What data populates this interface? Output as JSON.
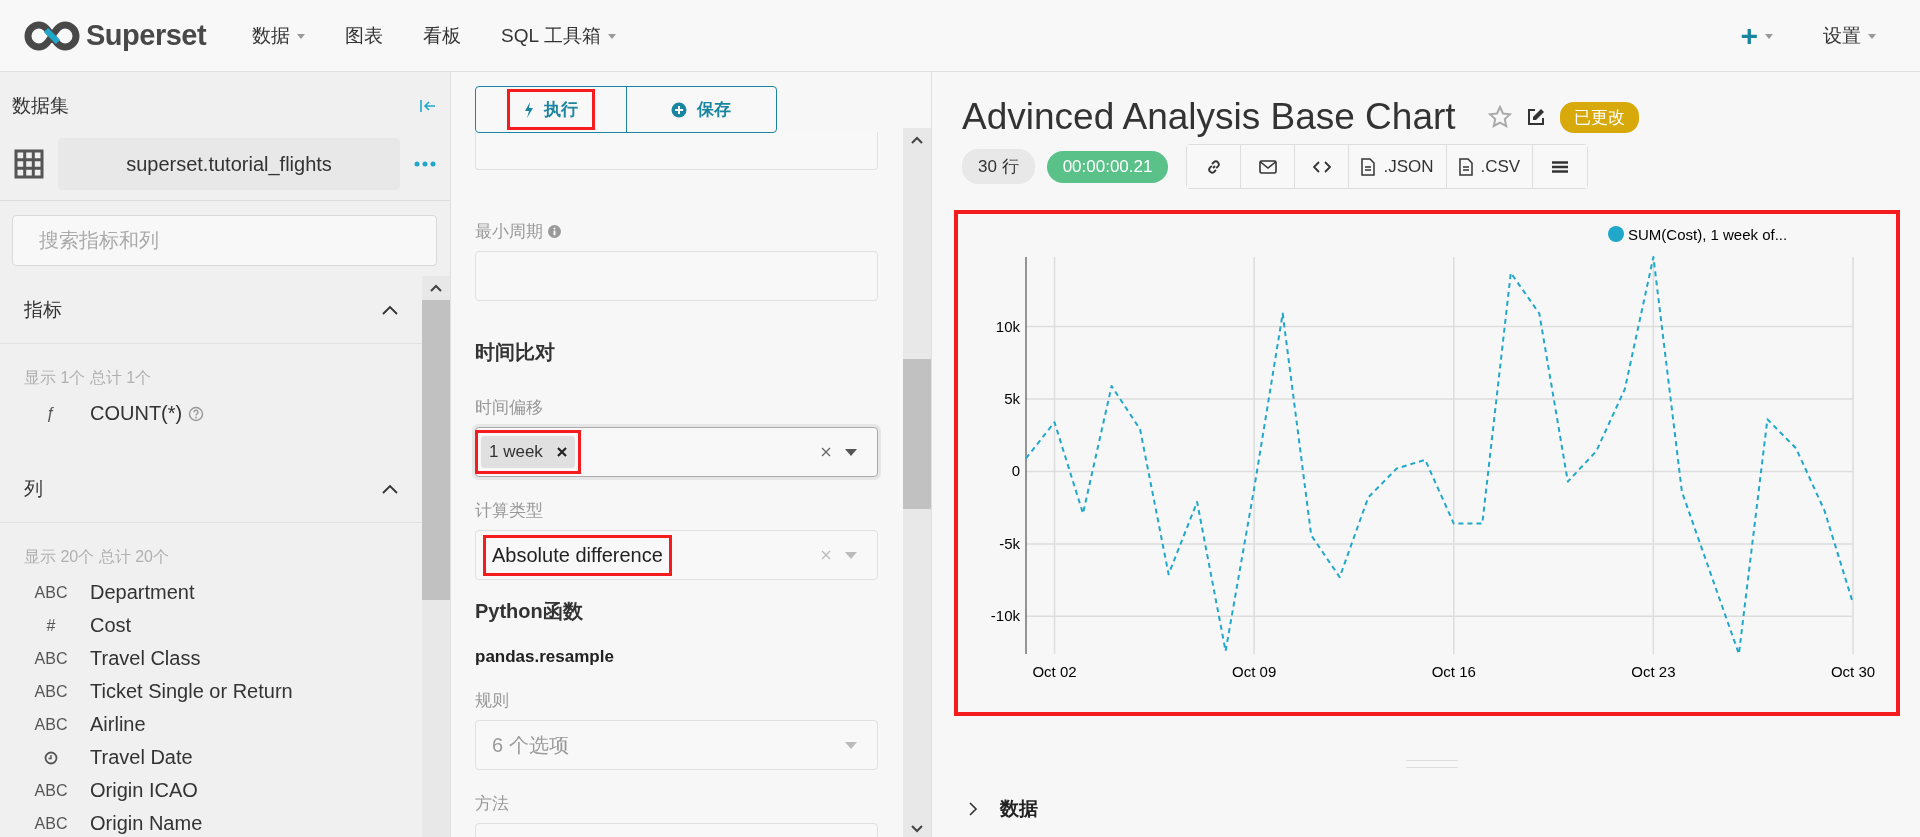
{
  "navbar": {
    "brand": "Superset",
    "menus": [
      {
        "label": "数据",
        "dropdown": true
      },
      {
        "label": "图表",
        "dropdown": false
      },
      {
        "label": "看板",
        "dropdown": false
      },
      {
        "label": "SQL 工具箱",
        "dropdown": true
      }
    ],
    "right_menus": [
      {
        "label": "+",
        "dropdown": true
      },
      {
        "label": "设置",
        "dropdown": true
      }
    ]
  },
  "datasource_panel": {
    "title": "数据集",
    "dataset": "superset.tutorial_flights",
    "search": {
      "placeholder": "搜索指标和列"
    },
    "sections": [
      {
        "title": "指标",
        "expanded": true,
        "count": "显示 1个 总计 1个",
        "items": [
          {
            "kind": "label",
            "type": "ƒ",
            "name": "COUNT(*)",
            "help": true
          }
        ]
      },
      {
        "title": "列",
        "expanded": true,
        "count": "显示 20个 总计 20个",
        "items": [
          {
            "kind": "label",
            "type": "ABC",
            "name": "Department",
            "help": false
          },
          {
            "kind": "label",
            "type": "#",
            "name": "Cost",
            "help": false
          },
          {
            "kind": "label",
            "type": "ABC",
            "name": "Travel Class",
            "help": false
          },
          {
            "kind": "label",
            "type": "ABC",
            "name": "Ticket Single or Return",
            "help": false
          },
          {
            "kind": "label",
            "type": "ABC",
            "name": "Airline",
            "help": false
          },
          {
            "kind": "clock",
            "name": "Travel Date",
            "help": false
          },
          {
            "kind": "label",
            "type": "ABC",
            "name": "Origin ICAO",
            "help": false
          },
          {
            "kind": "label",
            "type": "ABC",
            "name": "Origin Name",
            "help": false
          }
        ]
      }
    ]
  },
  "control_panel": {
    "buttons": [
      {
        "label": "执行",
        "kind": "run",
        "highlighted": true
      },
      {
        "label": "保存",
        "kind": "save",
        "highlighted": false
      }
    ],
    "controls": [
      {
        "kind": "cut-field"
      },
      {
        "kind": "text",
        "label": "最小周期",
        "info": true
      },
      {
        "kind": "heading",
        "label": "时间比对"
      },
      {
        "kind": "tags",
        "label": "时间偏移",
        "tags": [
          "1 week"
        ],
        "highlighted": true,
        "focused": true
      },
      {
        "kind": "select",
        "label": "计算类型",
        "value": "Absolute difference",
        "clearable": true,
        "highlighted": true
      },
      {
        "kind": "heading",
        "label": "Python函数"
      },
      {
        "kind": "subheading",
        "label": "pandas.resample"
      },
      {
        "kind": "select",
        "label": "规则",
        "placeholder": "6 个选项",
        "clearable": false,
        "highlighted": false
      },
      {
        "kind": "cut-select",
        "label": "方法"
      }
    ]
  },
  "chart_panel": {
    "title": "Advinced Analysis Base Chart",
    "favorite": false,
    "status": "已更改",
    "row_count": "30 行",
    "timer": "00:00:00.21",
    "actions": [
      {
        "kind": "link"
      },
      {
        "kind": "email"
      },
      {
        "kind": "embed"
      },
      {
        "kind": "json",
        "label": ".JSON"
      },
      {
        "kind": "csv",
        "label": ".CSV"
      },
      {
        "kind": "menu"
      }
    ],
    "highlighted": true,
    "chart_data": {
      "type": "line",
      "grid": true,
      "categories": [
        null,
        "Oct 02",
        null,
        null,
        null,
        null,
        null,
        null,
        "Oct 09",
        null,
        null,
        null,
        null,
        null,
        null,
        "Oct 16",
        null,
        null,
        null,
        null,
        null,
        null,
        "Oct 23",
        null,
        null,
        null,
        null,
        null,
        null,
        "Oct 30"
      ],
      "ylim": [
        -12600,
        14800
      ],
      "yticks": [
        {
          "value": -10000,
          "label": "-10k"
        },
        {
          "value": -5000,
          "label": "-5k"
        },
        {
          "value": 0,
          "label": "0"
        },
        {
          "value": 5000,
          "label": "5k"
        },
        {
          "value": 10000,
          "label": "10k"
        }
      ],
      "series": [
        {
          "name": "SUM(Cost), 1 week of...",
          "color": "#1fa8c9",
          "line_style": "dashed",
          "values": [
            900,
            3400,
            -2900,
            5900,
            2900,
            -7100,
            -2100,
            -12400,
            -1200,
            10900,
            -4400,
            -7300,
            -1800,
            200,
            800,
            -3600,
            -3600,
            13700,
            10900,
            -700,
            1400,
            5700,
            14800,
            -1400,
            -7000,
            -12600,
            3600,
            1600,
            -2700,
            -9100
          ]
        }
      ]
    },
    "data_section": {
      "label": "数据",
      "expanded": false
    }
  }
}
